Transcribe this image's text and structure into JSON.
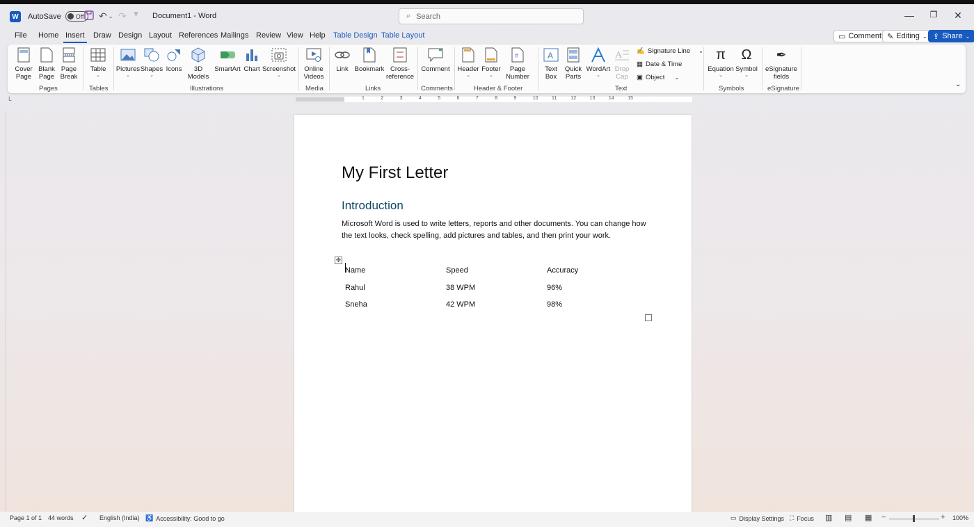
{
  "titlebar": {
    "autosave_label": "AutoSave",
    "autosave_state": "Off",
    "document_title": "Document1  -  Word",
    "search_placeholder": "Search"
  },
  "menu": {
    "items": [
      "File",
      "Home",
      "Insert",
      "Draw",
      "Design",
      "Layout",
      "References",
      "Mailings",
      "Review",
      "View",
      "Help",
      "Table Design",
      "Table Layout"
    ],
    "active": "Insert"
  },
  "actions": {
    "comments": "Comments",
    "editing": "Editing",
    "share": "Share"
  },
  "ribbon": {
    "pages": {
      "label": "Pages",
      "cover_page": "Cover\nPage",
      "blank_page": "Blank\nPage",
      "page_break": "Page\nBreak"
    },
    "tables": {
      "label": "Tables",
      "table": "Table"
    },
    "illustrations": {
      "label": "Illustrations",
      "pictures": "Pictures",
      "shapes": "Shapes",
      "icons": "Icons",
      "models": "3D\nModels",
      "smartart": "SmartArt",
      "chart": "Chart",
      "screenshot": "Screenshot"
    },
    "media": {
      "label": "Media",
      "online_videos": "Online\nVideos"
    },
    "links": {
      "label": "Links",
      "link": "Link",
      "bookmark": "Bookmark",
      "cross_reference": "Cross-\nreference"
    },
    "comments": {
      "label": "Comments",
      "comment": "Comment"
    },
    "header_footer": {
      "label": "Header & Footer",
      "header": "Header",
      "footer": "Footer",
      "page_number": "Page\nNumber"
    },
    "text": {
      "label": "Text",
      "text_box": "Text\nBox",
      "quick_parts": "Quick\nParts",
      "wordart": "WordArt",
      "drop_cap": "Drop\nCap",
      "signature_line": "Signature Line",
      "date_time": "Date & Time",
      "object": "Object"
    },
    "symbols": {
      "label": "Symbols",
      "equation": "Equation",
      "symbol": "Symbol"
    },
    "esignature": {
      "label": "eSignature",
      "fields": "eSignature\nfields"
    }
  },
  "ruler_numbers": [
    "1",
    "2",
    "3",
    "4",
    "5",
    "6",
    "7",
    "8",
    "9",
    "10",
    "11",
    "12",
    "13",
    "14",
    "15"
  ],
  "document": {
    "title": "My First Letter",
    "heading": "Introduction",
    "paragraph": "Microsoft Word is used to write letters, reports and other documents. You can change how the text looks, check spelling, add pictures and tables, and then print your work.",
    "table": {
      "headers": [
        "Name",
        "Speed",
        "Accuracy"
      ],
      "rows": [
        [
          "Rahul",
          "38 WPM",
          "96%"
        ],
        [
          "Sneha",
          "42 WPM",
          "98%"
        ]
      ]
    }
  },
  "status": {
    "page": "Page 1 of 1",
    "words": "44 words",
    "language": "English (India)",
    "accessibility": "Accessibility: Good to go",
    "display_settings": "Display Settings",
    "focus": "Focus",
    "zoom": "100%"
  },
  "colors": {
    "accent": "#185abd",
    "heading": "#0f4761"
  }
}
